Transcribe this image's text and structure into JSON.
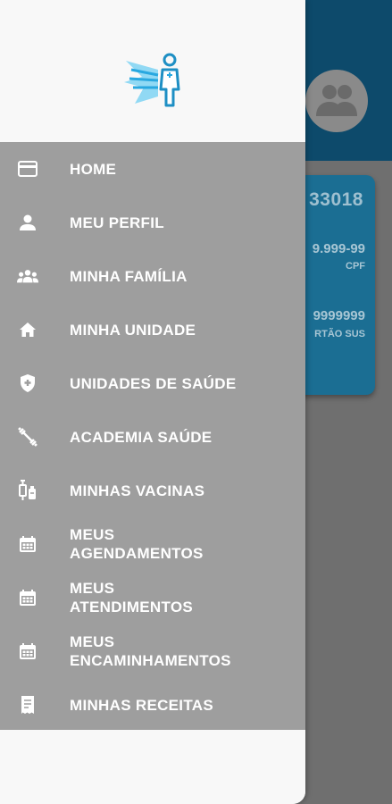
{
  "background": {
    "card_id": "33018",
    "cpf_value": "9.999-99",
    "cpf_label": "CPF",
    "sus_value": "9999999",
    "sus_label": "RTÃO SUS"
  },
  "menu": {
    "items": [
      {
        "label": "HOME",
        "icon": "credit-card-icon"
      },
      {
        "label": "MEU PERFIL",
        "icon": "person-icon"
      },
      {
        "label": "MINHA FAMÍLIA",
        "icon": "family-icon"
      },
      {
        "label": "MINHA UNIDADE",
        "icon": "home-icon"
      },
      {
        "label": "UNIDADES DE SAÚDE",
        "icon": "shield-plus-icon"
      },
      {
        "label": "ACADEMIA SAÚDE",
        "icon": "dumbbell-icon"
      },
      {
        "label": "MINHAS VACINAS",
        "icon": "vaccine-icon"
      },
      {
        "label": "MEUS\nAGENDAMENTOS",
        "icon": "calendar-icon"
      },
      {
        "label": "MEUS\nATENDIMENTOS",
        "icon": "calendar-icon"
      },
      {
        "label": "MEUS\nENCAMINHAMENTOS",
        "icon": "calendar-icon"
      },
      {
        "label": "MINHAS RECEITAS",
        "icon": "receipt-icon"
      }
    ]
  },
  "colors": {
    "header_bg": "#0d4a6b",
    "card_bg": "#1b6e93",
    "menu_bg": "#9e9e9e",
    "logo_accent": "#29a8e0"
  }
}
